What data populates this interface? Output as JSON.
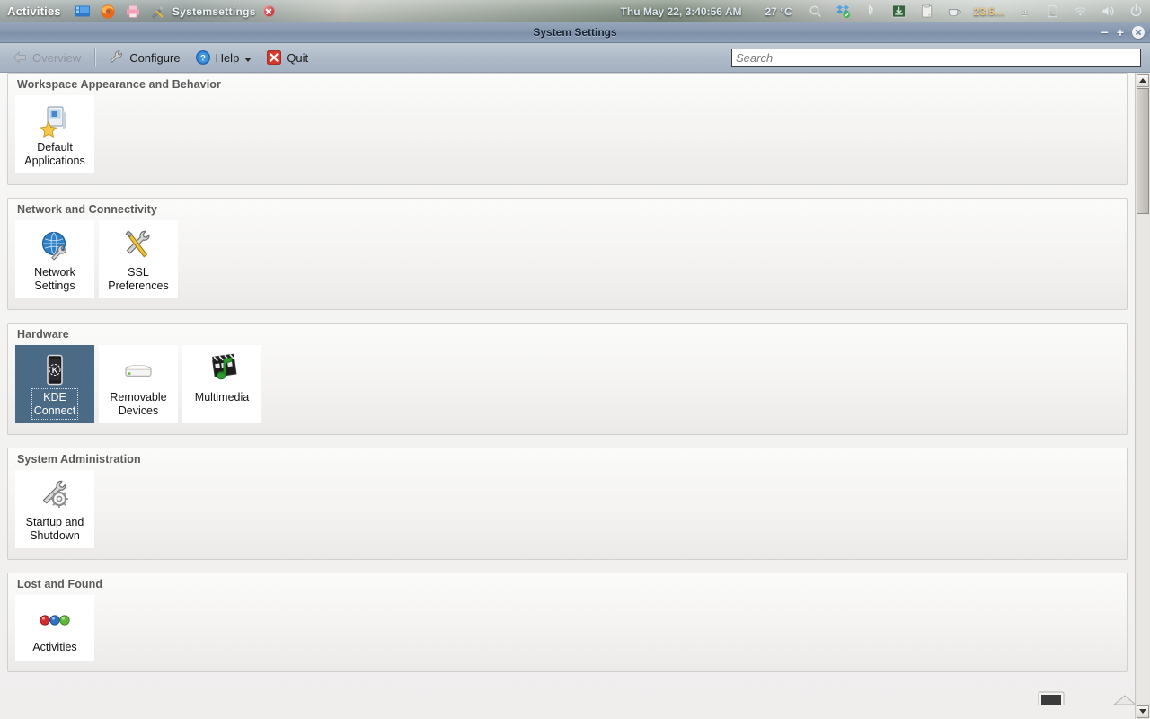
{
  "desktop": {
    "panel": {
      "activities_label": "Activities",
      "task_label": "Systemsettings",
      "launchers": [
        "desktop-icon",
        "firefox-icon",
        "printer-icon",
        "tools-icon"
      ],
      "clock": "Thu May 22, 3:40:56 AM",
      "temperature": "27 °C",
      "tray_number": "23.5…",
      "tray_icons": [
        "magnifier-icon",
        "dropbox-icon",
        "bluetooth-icon",
        "download-icon",
        "clipboard-icon",
        "coffee-icon",
        "input-method-icon",
        "document-icon",
        "wifi-icon",
        "volume-icon",
        "power-icon"
      ]
    }
  },
  "window": {
    "title": "System Settings",
    "controls": {
      "minimize": "−",
      "maximize": "+",
      "close": "close-icon"
    }
  },
  "toolbar": {
    "overview_label": "Overview",
    "configure_label": "Configure",
    "help_label": "Help",
    "quit_label": "Quit"
  },
  "search": {
    "placeholder": "Search",
    "value": ""
  },
  "scrollbar": {
    "up_label": "scroll-up",
    "down_label": "scroll-down"
  },
  "sections": [
    {
      "title": "Workspace Appearance and Behavior",
      "items": [
        {
          "label": "Default\nApplications",
          "label_lines": [
            "Default",
            "Applications"
          ],
          "icon": "default-applications-icon",
          "selected": false
        }
      ]
    },
    {
      "title": "Network and Connectivity",
      "items": [
        {
          "label_lines": [
            "Network",
            "Settings"
          ],
          "icon": "network-settings-icon",
          "selected": false
        },
        {
          "label_lines": [
            "SSL",
            "Preferences"
          ],
          "icon": "ssl-preferences-icon",
          "selected": false
        }
      ]
    },
    {
      "title": "Hardware",
      "items": [
        {
          "label_lines": [
            "KDE",
            "Connect"
          ],
          "icon": "kde-connect-icon",
          "selected": true
        },
        {
          "label_lines": [
            "Removable",
            "Devices"
          ],
          "icon": "removable-devices-icon",
          "selected": false
        },
        {
          "label_lines": [
            "Multimedia"
          ],
          "icon": "multimedia-icon",
          "selected": false
        }
      ]
    },
    {
      "title": "System Administration",
      "items": [
        {
          "label_lines": [
            "Startup and",
            "Shutdown"
          ],
          "icon": "startup-shutdown-icon",
          "selected": false
        }
      ]
    },
    {
      "title": "Lost and Found",
      "items": [
        {
          "label_lines": [
            "Activities"
          ],
          "icon": "activities-dots-icon",
          "selected": false
        }
      ]
    }
  ],
  "colors": {
    "selection": "#4a6a85",
    "titlebar": "#8597ae",
    "toolbar": "#aeb9c8",
    "section_title": "#5a5a5a",
    "content_bg": "#f3f2f1"
  }
}
